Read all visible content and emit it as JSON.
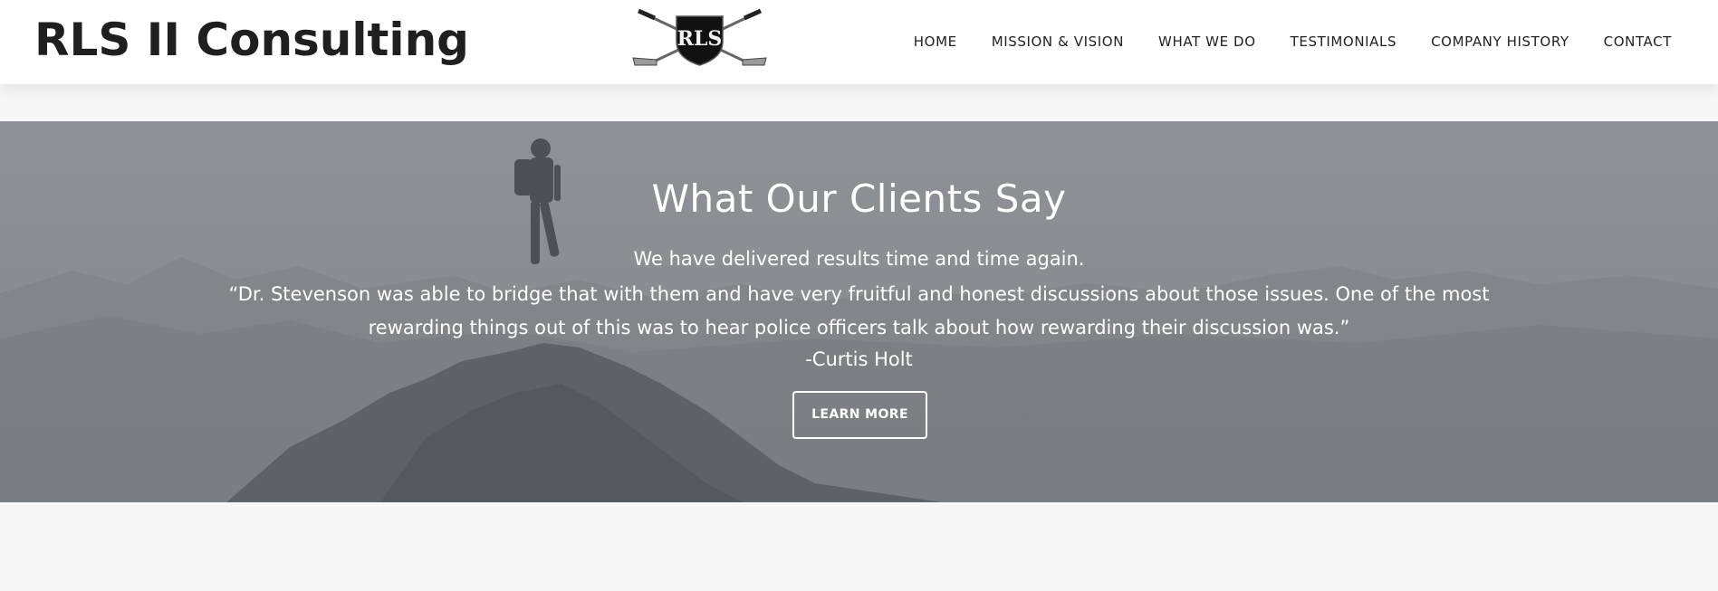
{
  "header": {
    "brand": "RLS II Consulting",
    "logo_text": "RLS",
    "nav": [
      {
        "label": "HOME"
      },
      {
        "label": "MISSION & VISION"
      },
      {
        "label": "WHAT WE DO"
      },
      {
        "label": "TESTIMONIALS"
      },
      {
        "label": "COMPANY HISTORY"
      },
      {
        "label": "CONTACT"
      }
    ]
  },
  "hero": {
    "title": "What Our Clients Say",
    "subtitle": "We have delivered results time and time again.",
    "quote": "“Dr. Stevenson was able to bridge that with them and have very fruitful and honest discussions about those issues. One of the most rewarding things out of this was to hear police officers talk about how rewarding their discussion was.”",
    "author": "-Curtis Holt",
    "button_label": "LEARN MORE"
  },
  "colors": {
    "header_bg": "#ffffff",
    "brand_text": "#1f1f1f",
    "hero_overlay": "#8a8d91",
    "hero_text": "#ffffff",
    "page_bg": "#f7f7f7"
  }
}
